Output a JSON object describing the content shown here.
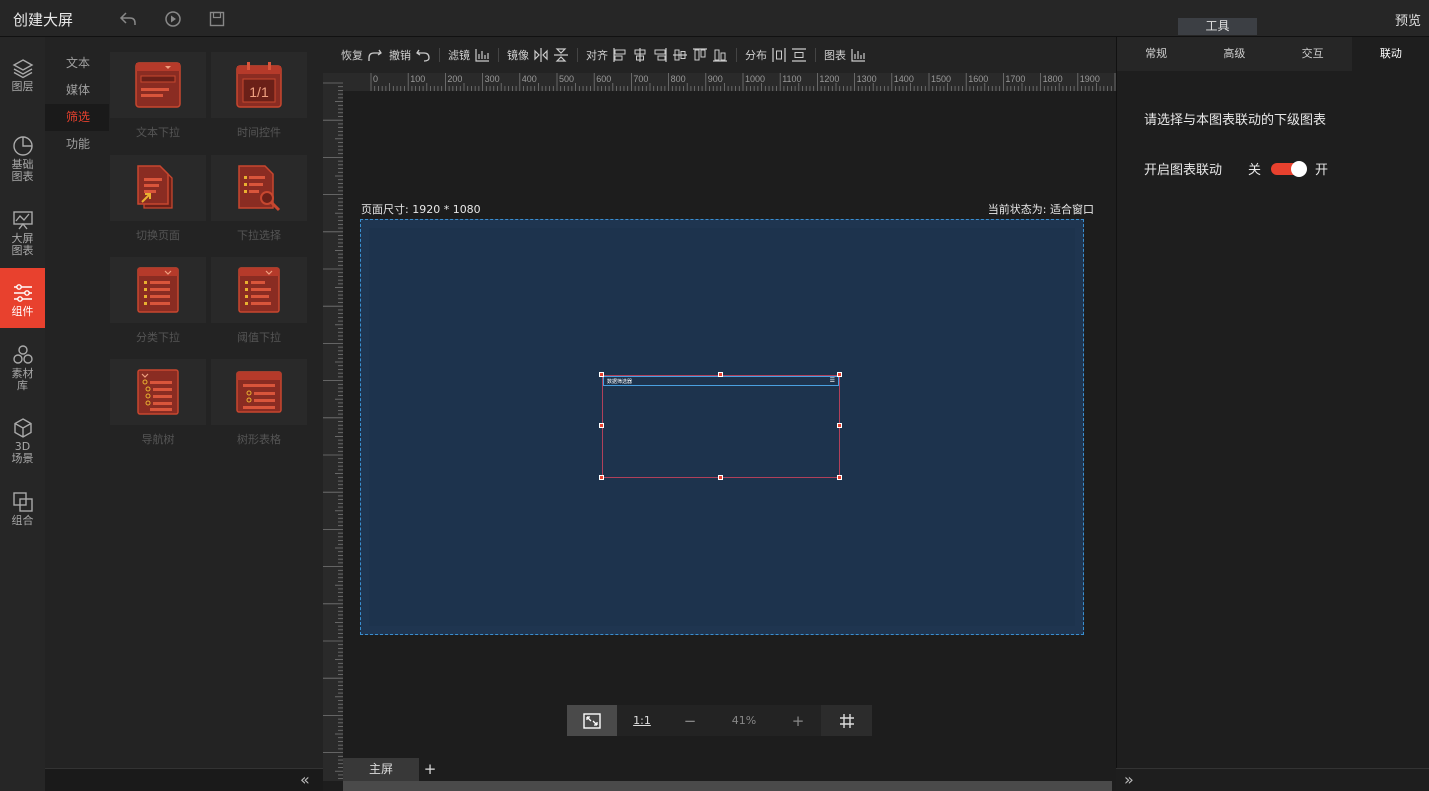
{
  "topbar": {
    "title": "创建大屏",
    "tools_tab": "工具",
    "preview": "预览"
  },
  "leftnav": [
    {
      "label": "图层",
      "icon": "layers-icon"
    },
    {
      "label": "基础\n图表",
      "icon": "pie-chart-icon"
    },
    {
      "label": "大屏\n图表",
      "icon": "monitor-chart-icon"
    },
    {
      "label": "组件",
      "icon": "sliders-icon",
      "active": true
    },
    {
      "label": "素材\n库",
      "icon": "hexagons-icon"
    },
    {
      "label": "3D\n场景",
      "icon": "cube-icon"
    },
    {
      "label": "组合",
      "icon": "group-icon"
    }
  ],
  "sub_tabs": [
    {
      "label": "文本"
    },
    {
      "label": "媒体"
    },
    {
      "label": "筛选",
      "active": true
    },
    {
      "label": "功能"
    }
  ],
  "components": [
    {
      "label": "文本下拉",
      "icon": "text-dropdown-icon"
    },
    {
      "label": "时间控件",
      "icon": "calendar-icon",
      "value": "1/1"
    },
    {
      "label": "切换页面",
      "icon": "switch-page-icon"
    },
    {
      "label": "下拉选择",
      "icon": "dropdown-search-icon"
    },
    {
      "label": "分类下拉",
      "icon": "category-dropdown-icon"
    },
    {
      "label": "阈值下拉",
      "icon": "threshold-dropdown-icon"
    },
    {
      "label": "导航树",
      "icon": "nav-tree-icon"
    },
    {
      "label": "树形表格",
      "icon": "tree-table-icon"
    }
  ],
  "toolbar": {
    "restore": "恢复",
    "undo": "撤销",
    "filter": "滤镜",
    "mirror": "镜像",
    "align": "对齐",
    "distribute": "分布",
    "chart": "图表"
  },
  "ruler_h_labels": [
    "0",
    "100",
    "200",
    "300",
    "400",
    "500",
    "600",
    "700",
    "800",
    "900",
    "1000",
    "1100",
    "1200",
    "1300",
    "1400",
    "1500",
    "1600",
    "1700",
    "1800",
    "1900",
    "20"
  ],
  "canvas": {
    "page_size": "页面尺寸: 1920 * 1080",
    "page_state": "当前状态为: 适合窗口",
    "widget_title": "数据筛选器",
    "widget_menu": "☰"
  },
  "zoombar": {
    "one_to_one": "1:1",
    "minus": "−",
    "zoom": "41%",
    "plus": "+"
  },
  "screen_tabs": {
    "main": "主屏",
    "add": "+"
  },
  "rightpanel": {
    "tabs": [
      {
        "label": "常规"
      },
      {
        "label": "高级"
      },
      {
        "label": "交互"
      },
      {
        "label": "联动",
        "active": true
      }
    ],
    "heading": "请选择与本图表联动的下级图表",
    "link_label": "开启图表联动",
    "off": "关",
    "on": "开",
    "link_enabled": true
  },
  "colors": {
    "accent": "#e8412e",
    "page_bg": "#1f3550",
    "frame": "#3a8fd0"
  }
}
